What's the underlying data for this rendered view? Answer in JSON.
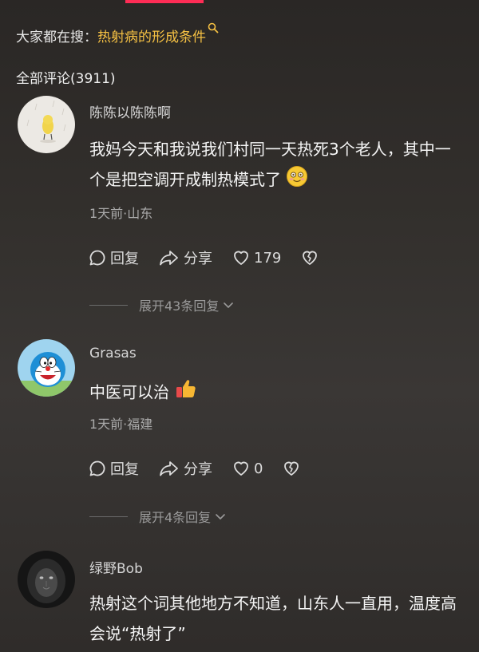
{
  "search": {
    "prefix": "大家都在搜：",
    "keyword": "热射病的形成条件"
  },
  "comments_header": {
    "title": "全部评论(3911)"
  },
  "comments": [
    {
      "username": "陈陈以陈陈啊",
      "text": "我妈今天和我说我们村同一天热死3个老人，其中一个是把空调开成制热模式了",
      "meta": "1天前·山东",
      "reply_label": "回复",
      "share_label": "分享",
      "like_count": "179",
      "expand_label": "展开43条回复"
    },
    {
      "username": "Grasas",
      "text": "中医可以治",
      "meta": "1天前·福建",
      "reply_label": "回复",
      "share_label": "分享",
      "like_count": "0",
      "expand_label": "展开4条回复"
    },
    {
      "username": "绿野Bob",
      "text": "热射这个词其他地方不知道，山东人一直用，温度高会说“热射了”"
    }
  ],
  "colors": {
    "accent": "#fe2c55",
    "keyword": "#f5c043",
    "meta": "#a9a9a9"
  }
}
